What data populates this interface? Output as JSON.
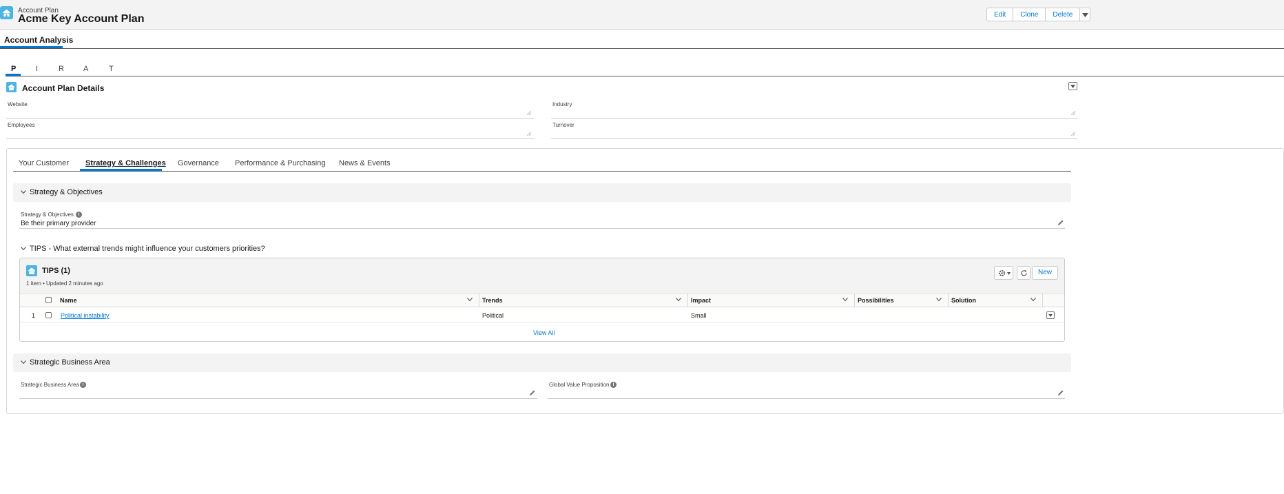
{
  "header": {
    "object_type": "Account Plan",
    "record_name": "Acme Key Account Plan",
    "buttons": [
      "Edit",
      "Clone",
      "Delete"
    ]
  },
  "main_tab": {
    "label": "Account Analysis"
  },
  "pirat_tabs": [
    "P",
    "I",
    "R",
    "A",
    "T"
  ],
  "details": {
    "title": "Account Plan Details",
    "fields": {
      "website": "Website",
      "industry": "Industry",
      "employees": "Employees",
      "turnover": "Turnover"
    }
  },
  "subtabs": [
    "Your Customer",
    "Strategy & Challenges",
    "Governance",
    "Performance & Purchasing",
    "News & Events"
  ],
  "strategy_section": {
    "title": "Strategy & Objectives",
    "field_label": "Strategy & Objectives",
    "field_value": "Be their primary provider"
  },
  "tips_section": {
    "title": "TIPS - What external trends might influence your customers priorities?",
    "list_title": "TIPS (1)",
    "meta": "1 item • Updated 2 minutes ago",
    "new_label": "New",
    "columns": [
      "Name",
      "Trends",
      "Impact",
      "Possibilities",
      "Solution"
    ],
    "rows": [
      {
        "num": "1",
        "name": "Political instability",
        "trends": "Political",
        "impact": "Small",
        "possibilities": "",
        "solution": ""
      }
    ],
    "view_all": "View All"
  },
  "business_section": {
    "title": "Strategic Business Area",
    "field1_label": "Strategic Business Area",
    "field2_label": "Global Value Proposition"
  },
  "colors": {
    "accent": "#0176d3",
    "icon_bg": "#4bb4e0",
    "section_bg": "#f3f3f3"
  }
}
